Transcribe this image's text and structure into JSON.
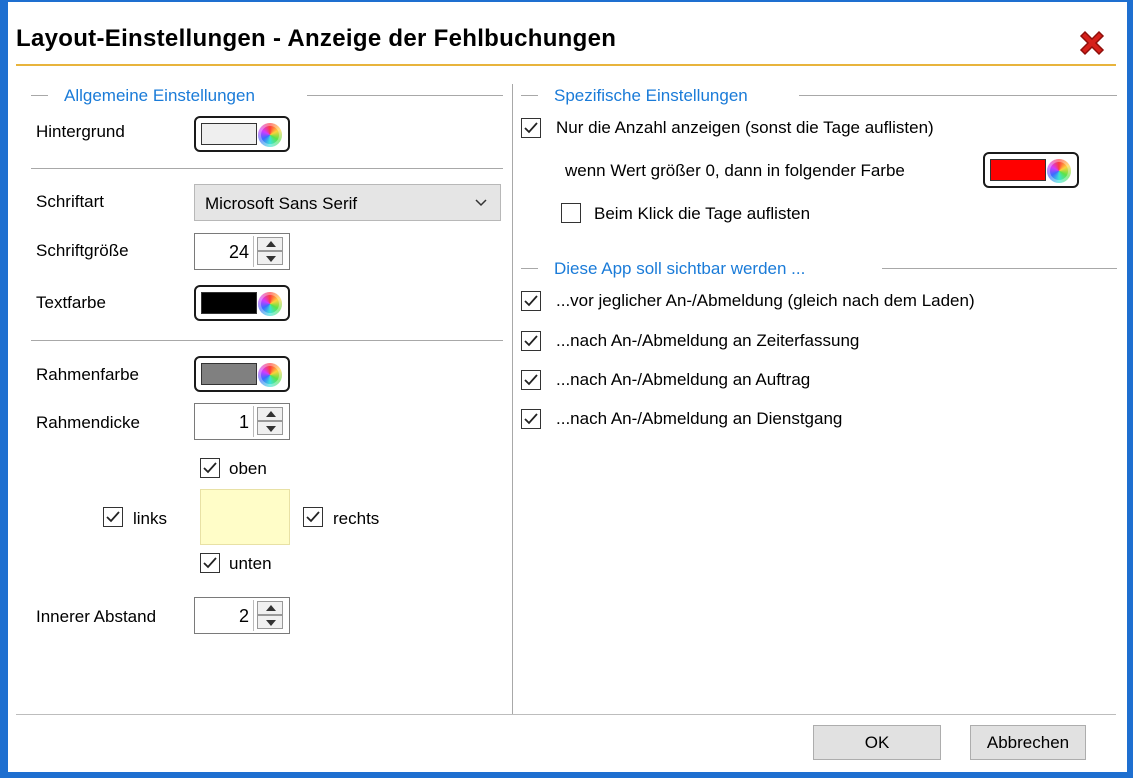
{
  "dialog": {
    "title": "Layout-Einstellungen - Anzeige der Fehlbuchungen",
    "close_icon": "close-x-icon"
  },
  "general": {
    "group_label": "Allgemeine Einstellungen",
    "background_label": "Hintergrund",
    "background_color": "#efefef",
    "font_label": "Schriftart",
    "font_value": "Microsoft Sans Serif",
    "font_size_label": "Schriftgröße",
    "font_size_value": "24",
    "text_color_label": "Textfarbe",
    "text_color": "#000000",
    "border_color_label": "Rahmenfarbe",
    "border_color": "#808080",
    "border_width_label": "Rahmendicke",
    "border_width_value": "1",
    "top_label": "oben",
    "left_label": "links",
    "right_label": "rechts",
    "bottom_label": "unten",
    "padding_label": "Innerer Abstand",
    "padding_value": "2",
    "preview_color": "#fffdc8"
  },
  "specific": {
    "group_label": "Spezifische Einstellungen",
    "count_only_label": "Nur die Anzahl anzeigen (sonst die Tage auflisten)",
    "count_only_checked": true,
    "color_label": "wenn Wert größer 0, dann in folgender Farbe",
    "highlight_color": "#ff0000",
    "click_list_label": "Beim Klick die Tage auflisten",
    "click_list_checked": false
  },
  "visibility": {
    "group_label": "Diese App soll sichtbar werden ...",
    "options": [
      {
        "label": "...vor jeglicher An-/Abmeldung (gleich nach dem Laden)",
        "checked": true
      },
      {
        "label": "...nach An-/Abmeldung an Zeiterfassung",
        "checked": true
      },
      {
        "label": "...nach An-/Abmeldung an Auftrag",
        "checked": true
      },
      {
        "label": "...nach An-/Abmeldung an Dienstgang",
        "checked": true
      }
    ]
  },
  "buttons": {
    "ok": "OK",
    "cancel": "Abbrechen"
  }
}
